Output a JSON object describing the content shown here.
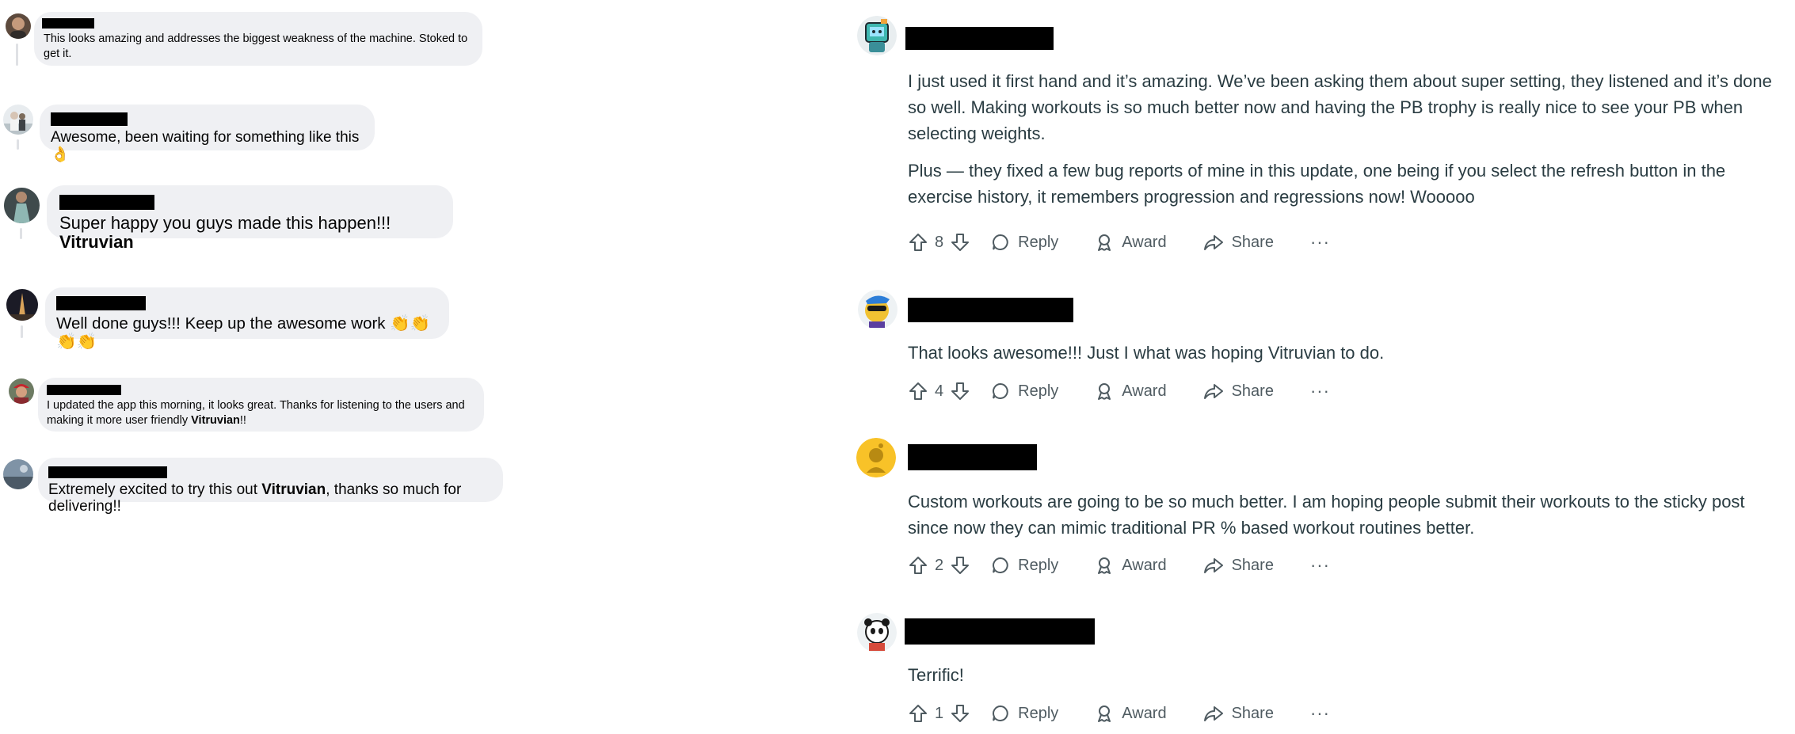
{
  "facebook_comments": [
    {
      "avatar": "avatar-bald-man",
      "text": [
        {
          "t": "This looks amazing and addresses the biggest weakness of the machine. Stoked to get it."
        }
      ]
    },
    {
      "avatar": "avatar-wedding-photo",
      "text": [
        {
          "t": "Awesome, been waiting for something like this "
        }
      ],
      "emoji": "👌"
    },
    {
      "avatar": "avatar-woman-dress",
      "text": [
        {
          "t": "Super happy you guys made this happen!!! "
        },
        {
          "t": "Vitruvian",
          "bold": true
        }
      ]
    },
    {
      "avatar": "avatar-night-tower",
      "text": [
        {
          "t": "Well done guys!!! Keep up the awesome work "
        }
      ],
      "emoji": "👏👏👏👏"
    },
    {
      "avatar": "avatar-man-red-cap",
      "text": [
        {
          "t": "I updated the app this morning, it looks great. Thanks for listening to the users and making it more user friendly "
        },
        {
          "t": "Vitruvian",
          "bold": true
        },
        {
          "t": "!!"
        }
      ]
    },
    {
      "avatar": "avatar-landscape",
      "text": [
        {
          "t": "Extremely excited to try this out "
        },
        {
          "t": "Vitruvian",
          "bold": true
        },
        {
          "t": ", thanks so much for delivering!!"
        }
      ]
    }
  ],
  "reddit_comments": [
    {
      "avatar": "avatar-robot-tv",
      "paragraphs": [
        "I just used it first hand and it’s amazing. We’ve been asking them about super setting, they listened and it’s done so well. Making workouts is so much better now and having the PB trophy is really nice to see your PB when selecting weights.",
        "Plus — they fixed a few bug reports of mine in this update, one being if you select the refresh button in the exercise history, it remembers progression and regressions now! Wooooo"
      ],
      "votes": "8"
    },
    {
      "avatar": "avatar-snoo-sunglasses",
      "paragraphs": [
        "That looks awesome!!! Just I what was hoping Vitruvian to do."
      ],
      "votes": "4"
    },
    {
      "avatar": "avatar-default-snoo",
      "paragraphs": [
        "Custom workouts are going to be so much better. I am hoping people submit their workouts to the sticky post since now they can mimic traditional PR % based workout routines better."
      ],
      "votes": "2"
    },
    {
      "avatar": "avatar-snoo-panda",
      "paragraphs": [
        "Terrific!"
      ],
      "votes": "1"
    }
  ],
  "reddit_actions": {
    "reply": "Reply",
    "award": "Award",
    "share": "Share",
    "more": "···"
  },
  "icons": {
    "upvote": "upvote-arrow-icon",
    "downvote": "downvote-arrow-icon",
    "reply": "speech-bubble-icon",
    "award": "award-ribbon-icon",
    "share": "share-arrow-icon",
    "more": "ellipsis-icon"
  },
  "colors": {
    "bubble": "#eff0f3",
    "redaction": "#000000",
    "reddit_text": "#2a3c42",
    "reddit_meta": "#4f5b61"
  }
}
